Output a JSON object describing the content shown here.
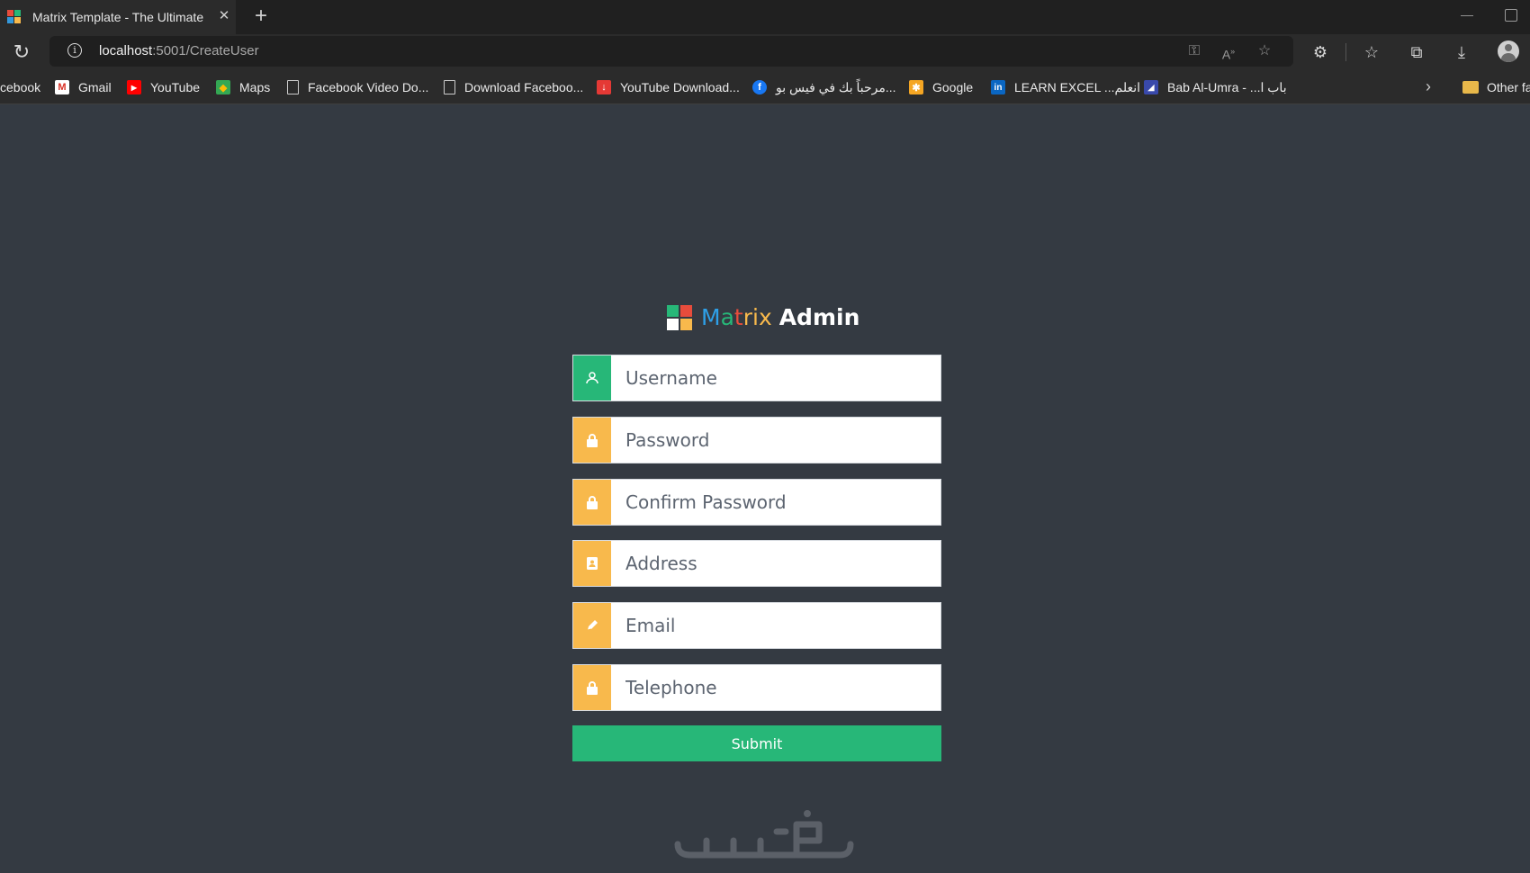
{
  "browser": {
    "tab_title": "Matrix Template - The Ultimate M",
    "close_glyph": "✕",
    "new_tab_glyph": "+",
    "url_host": "localhost",
    "url_rest": ":5001/CreateUser",
    "bookmarks": [
      {
        "label": "cebook"
      },
      {
        "label": "Gmail"
      },
      {
        "label": "YouTube"
      },
      {
        "label": "Maps"
      },
      {
        "label": "Facebook Video Do..."
      },
      {
        "label": "Download Faceboo..."
      },
      {
        "label": "YouTube Download..."
      },
      {
        "label": "مرحباً بك في فيس بو..."
      },
      {
        "label": "Google"
      },
      {
        "label": "LEARN EXCEL ...انعلم"
      },
      {
        "label": "Bab Al-Umra - ...باب ا"
      },
      {
        "label": "Other fa"
      }
    ]
  },
  "brand": {
    "name_m": "M",
    "name_a": "a",
    "name_t": "t",
    "name_rix": "rix",
    "admin": "Admin"
  },
  "form": {
    "username_placeholder": "Username",
    "password_placeholder": "Password",
    "confirm_password_placeholder": "Confirm Password",
    "address_placeholder": "Address",
    "email_placeholder": "Email",
    "telephone_placeholder": "Telephone",
    "submit_label": "Submit"
  },
  "colors": {
    "page_bg": "#343a42",
    "accent_green": "#27b778",
    "accent_orange": "#f8b94c"
  }
}
